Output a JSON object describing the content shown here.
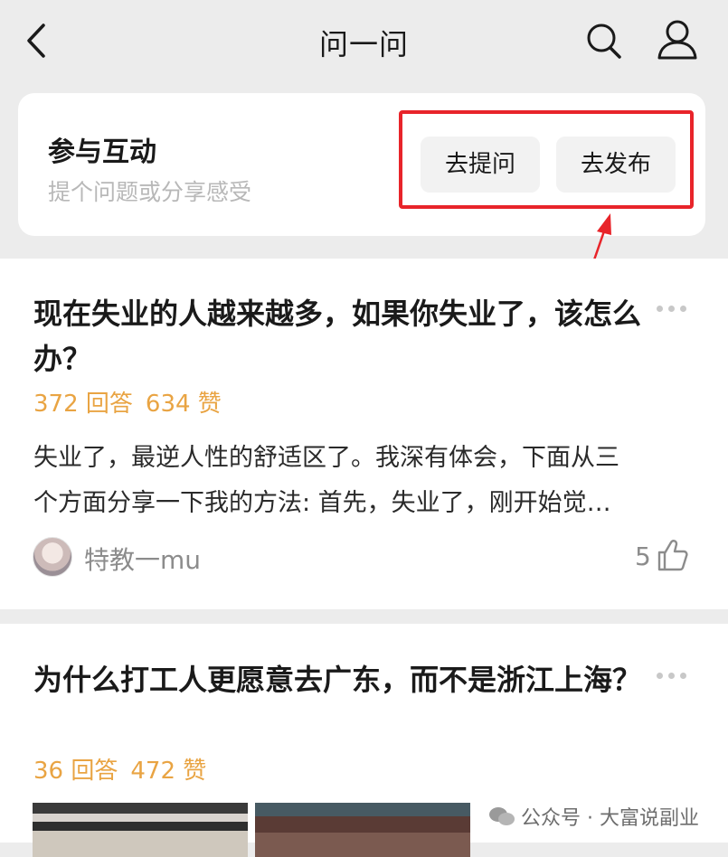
{
  "nav": {
    "title": "问一问"
  },
  "interact": {
    "title": "参与互动",
    "subtitle": "提个问题或分享感受",
    "ask_label": "去提问",
    "publish_label": "去发布"
  },
  "posts": [
    {
      "title": "现在失业的人越来越多，如果你失业了，该怎么办？",
      "answers": "372 回答",
      "likes_count": "634 赞",
      "excerpt_line1": "失业了，最逆人性的舒适区了。我深有体会，下面从三",
      "excerpt_line2": "个方面分享一下我的方法: 首先，失业了，刚开始觉…",
      "author": "特教一mu",
      "likes": "5"
    },
    {
      "title": "为什么打工人更愿意去广东，而不是浙江上海？",
      "answers": "36 回答",
      "likes_count": "472 赞"
    }
  ],
  "watermark": "公众号 · 大富说副业",
  "colors": {
    "accent_orange": "#e9a443",
    "highlight_red": "#e8242a"
  }
}
